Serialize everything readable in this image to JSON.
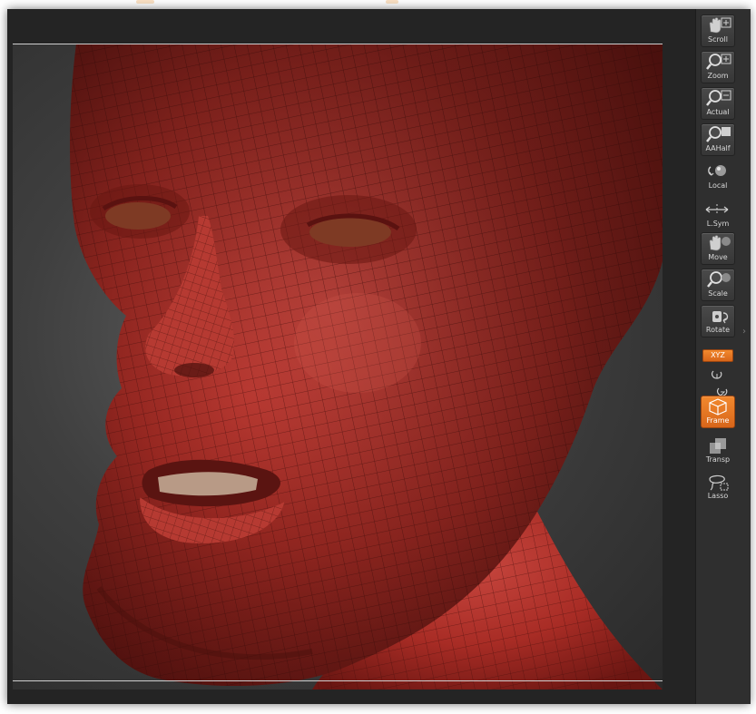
{
  "shelf": {
    "tools": [
      {
        "id": "scroll",
        "label": "Scroll",
        "icon": "hand-icon"
      },
      {
        "id": "zoom",
        "label": "Zoom",
        "icon": "magnifier-icon"
      },
      {
        "id": "actual",
        "label": "Actual",
        "icon": "magnifier-icon"
      },
      {
        "id": "aahalf",
        "label": "AAHalf",
        "icon": "magnifier-icon"
      },
      {
        "id": "local",
        "label": "Local",
        "icon": "local-icon"
      },
      {
        "id": "lsym",
        "label": "L.Sym",
        "icon": "symmetry-icon"
      },
      {
        "id": "move",
        "label": "Move",
        "icon": "hand-icon"
      },
      {
        "id": "scale",
        "label": "Scale",
        "icon": "magnifier-icon"
      },
      {
        "id": "rotate",
        "label": "Rotate",
        "icon": "rotate-icon"
      },
      {
        "id": "frame",
        "label": "Frame",
        "icon": "cube-icon"
      },
      {
        "id": "transp",
        "label": "Transp",
        "icon": "transparency-icon"
      },
      {
        "id": "lasso",
        "label": "Lasso",
        "icon": "lasso-icon"
      }
    ],
    "xyz_label": "XYZ",
    "accent": "#e8761f",
    "background": "#2f2f2f"
  },
  "viewport": {
    "model_color": "#b0302a",
    "background": "#3a3a3a"
  }
}
